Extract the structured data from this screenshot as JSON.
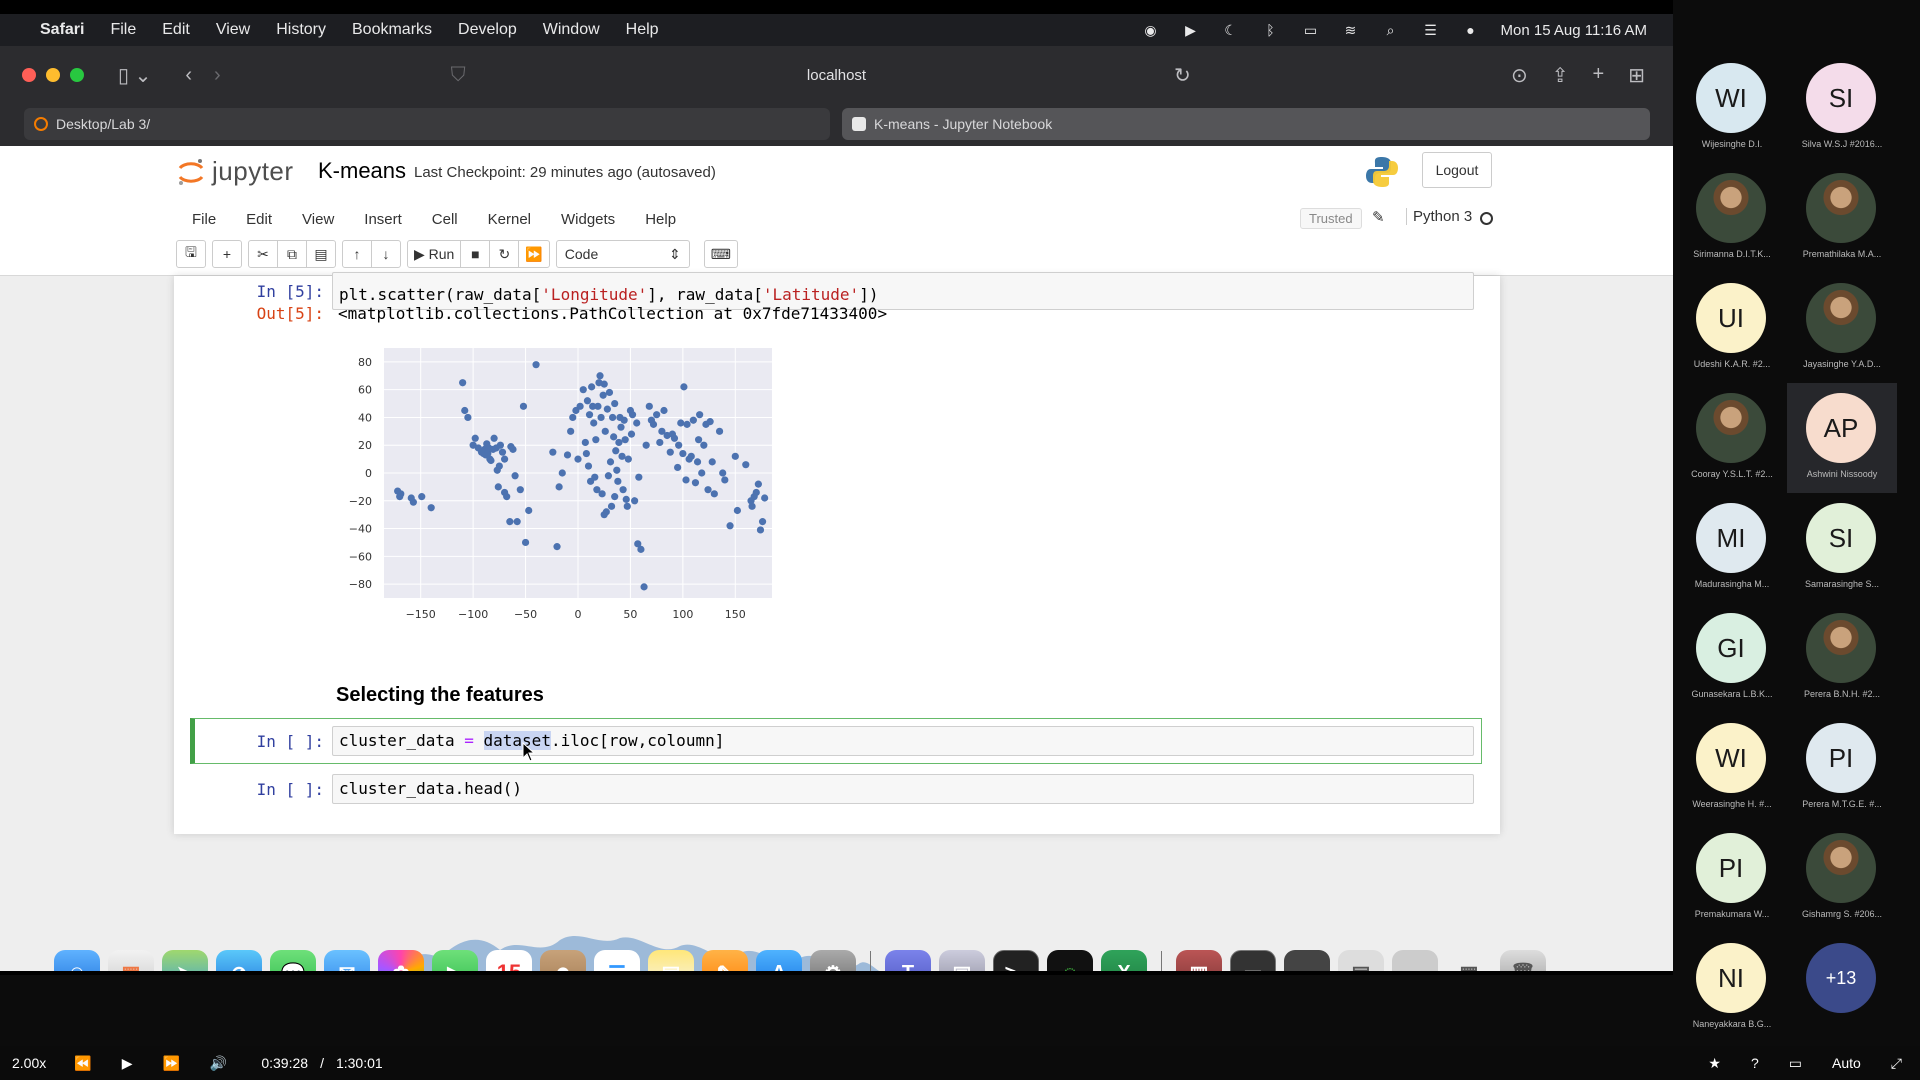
{
  "menubar": {
    "apple": "",
    "app": "Safari",
    "items": [
      "File",
      "Edit",
      "View",
      "History",
      "Bookmarks",
      "Develop",
      "Window",
      "Help"
    ],
    "clock": "Mon 15 Aug  11:16 AM"
  },
  "safari": {
    "url": "localhost",
    "tabs": [
      "Desktop/Lab 3/",
      "K-means - Jupyter Notebook"
    ]
  },
  "jupyter": {
    "logo_text": "jupyter",
    "notebook_title": "K-means",
    "checkpoint": "Last Checkpoint: 29 minutes ago  (autosaved)",
    "logout": "Logout",
    "menu": [
      "File",
      "Edit",
      "View",
      "Insert",
      "Cell",
      "Kernel",
      "Widgets",
      "Help"
    ],
    "trusted": "Trusted",
    "kernel": "Python 3",
    "toolbar": {
      "run": "Run",
      "cell_type": "Code"
    }
  },
  "cells": {
    "c1": {
      "prompt": "In [5]:",
      "code_a": "plt.scatter(raw_data[",
      "str1": "'Longitude'",
      "code_b": "], raw_data[",
      "str2": "'Latitude'",
      "code_c": "])",
      "out_prompt": "Out[5]:",
      "output": "<matplotlib.collections.PathCollection at 0x7fde71433400>"
    },
    "heading": "Selecting the features",
    "c2": {
      "prompt": "In [ ]:",
      "code_a": "cluster_data ",
      "op": "=",
      "code_sel": "dataset",
      "code_b": ".iloc[row,coloumn]"
    },
    "c3": {
      "prompt": "In [ ]:",
      "code": "cluster_data.head()"
    }
  },
  "chart_data": {
    "type": "scatter",
    "title": "",
    "xlabel": "",
    "ylabel": "",
    "xlim": [
      -185,
      185
    ],
    "ylim": [
      -90,
      90
    ],
    "xticks": [
      -150,
      -100,
      -50,
      0,
      50,
      100,
      150
    ],
    "yticks": [
      80,
      60,
      40,
      20,
      0,
      -20,
      -40,
      -60,
      -80
    ],
    "x_tick_labels": [
      "−150",
      "−100",
      "−50",
      "0",
      "50",
      "100",
      "150"
    ],
    "y_tick_labels": [
      "80",
      "60",
      "40",
      "20",
      "0",
      "−20",
      "−40",
      "−60",
      "−80"
    ],
    "grid": true,
    "color": "#4c72b0",
    "background": "#eaeaf2",
    "points": [
      [
        -172,
        -13
      ],
      [
        -170,
        -17
      ],
      [
        -169,
        -15
      ],
      [
        -159,
        -18
      ],
      [
        -157,
        -21
      ],
      [
        -149,
        -17
      ],
      [
        -140,
        -25
      ],
      [
        -110,
        65
      ],
      [
        -108,
        45
      ],
      [
        -105,
        40
      ],
      [
        -100,
        20
      ],
      [
        -98,
        25
      ],
      [
        -95,
        18
      ],
      [
        -92,
        15
      ],
      [
        -90,
        14
      ],
      [
        -89,
        17
      ],
      [
        -88,
        13
      ],
      [
        -87,
        21
      ],
      [
        -86,
        14
      ],
      [
        -85,
        18
      ],
      [
        -84,
        10
      ],
      [
        -83,
        9
      ],
      [
        -81,
        17
      ],
      [
        -80,
        25
      ],
      [
        -78,
        18
      ],
      [
        -77,
        2
      ],
      [
        -76,
        -10
      ],
      [
        -75,
        5
      ],
      [
        -74,
        20
      ],
      [
        -72,
        15
      ],
      [
        -70,
        -14
      ],
      [
        -70,
        10
      ],
      [
        -68,
        -17
      ],
      [
        -65,
        -35
      ],
      [
        -64,
        19
      ],
      [
        -62,
        17
      ],
      [
        -60,
        -2
      ],
      [
        -58,
        -35
      ],
      [
        -55,
        -12
      ],
      [
        -52,
        48
      ],
      [
        -50,
        -50
      ],
      [
        -47,
        -27
      ],
      [
        -40,
        78
      ],
      [
        -24,
        15
      ],
      [
        -20,
        -53
      ],
      [
        -18,
        -10
      ],
      [
        -15,
        0
      ],
      [
        -10,
        13
      ],
      [
        -7,
        30
      ],
      [
        -5,
        40
      ],
      [
        -2,
        45
      ],
      [
        0,
        10
      ],
      [
        2,
        48
      ],
      [
        5,
        60
      ],
      [
        7,
        22
      ],
      [
        8,
        14
      ],
      [
        9,
        52
      ],
      [
        10,
        5
      ],
      [
        11,
        42
      ],
      [
        12,
        -6
      ],
      [
        13,
        62
      ],
      [
        14,
        48
      ],
      [
        15,
        36
      ],
      [
        16,
        -3
      ],
      [
        17,
        24
      ],
      [
        18,
        -12
      ],
      [
        19,
        48
      ],
      [
        20,
        65
      ],
      [
        21,
        70
      ],
      [
        22,
        40
      ],
      [
        23,
        -15
      ],
      [
        24,
        56
      ],
      [
        25,
        -30
      ],
      [
        25,
        64
      ],
      [
        26,
        30
      ],
      [
        27,
        -28
      ],
      [
        28,
        46
      ],
      [
        29,
        -2
      ],
      [
        30,
        58
      ],
      [
        31,
        8
      ],
      [
        32,
        -24
      ],
      [
        33,
        40
      ],
      [
        34,
        26
      ],
      [
        35,
        50
      ],
      [
        35,
        -17
      ],
      [
        36,
        16
      ],
      [
        37,
        2
      ],
      [
        38,
        -6
      ],
      [
        39,
        22
      ],
      [
        40,
        40
      ],
      [
        41,
        33
      ],
      [
        42,
        12
      ],
      [
        43,
        -12
      ],
      [
        44,
        38
      ],
      [
        45,
        24
      ],
      [
        46,
        -19
      ],
      [
        47,
        -24
      ],
      [
        48,
        10
      ],
      [
        50,
        45
      ],
      [
        51,
        28
      ],
      [
        52,
        42
      ],
      [
        54,
        -20
      ],
      [
        56,
        36
      ],
      [
        57,
        -51
      ],
      [
        58,
        -3
      ],
      [
        60,
        -55
      ],
      [
        63,
        -82
      ],
      [
        65,
        20
      ],
      [
        68,
        48
      ],
      [
        70,
        38
      ],
      [
        72,
        35
      ],
      [
        75,
        42
      ],
      [
        78,
        22
      ],
      [
        80,
        30
      ],
      [
        82,
        45
      ],
      [
        85,
        27
      ],
      [
        88,
        15
      ],
      [
        90,
        28
      ],
      [
        92,
        25
      ],
      [
        95,
        4
      ],
      [
        96,
        20
      ],
      [
        98,
        36
      ],
      [
        100,
        14
      ],
      [
        101,
        62
      ],
      [
        103,
        -5
      ],
      [
        104,
        35
      ],
      [
        106,
        10
      ],
      [
        108,
        12
      ],
      [
        110,
        38
      ],
      [
        112,
        -7
      ],
      [
        114,
        8
      ],
      [
        115,
        24
      ],
      [
        116,
        42
      ],
      [
        118,
        0
      ],
      [
        120,
        20
      ],
      [
        122,
        35
      ],
      [
        124,
        -12
      ],
      [
        126,
        37
      ],
      [
        128,
        8
      ],
      [
        130,
        -15
      ],
      [
        135,
        30
      ],
      [
        138,
        0
      ],
      [
        140,
        -5
      ],
      [
        145,
        -38
      ],
      [
        150,
        12
      ],
      [
        152,
        -27
      ],
      [
        160,
        6
      ],
      [
        165,
        -20
      ],
      [
        166,
        -24
      ],
      [
        168,
        -17
      ],
      [
        170,
        -14
      ],
      [
        172,
        -8
      ],
      [
        174,
        -41
      ],
      [
        176,
        -35
      ],
      [
        178,
        -18
      ]
    ]
  },
  "dock": {
    "calendar_day": "15",
    "apps": [
      "finder",
      "launchpad",
      "maps",
      "safari",
      "messages",
      "mail",
      "photos",
      "facetime",
      "calendar",
      "contacts",
      "reminders",
      "notes",
      "pages",
      "app-store",
      "system-preferences",
      "teams",
      "preview",
      "terminal",
      "activity",
      "excel",
      "photo-booth",
      "screenshot",
      "trash"
    ]
  },
  "player": {
    "speed": "2.00x",
    "current": "0:39:28",
    "separator": "/",
    "total": "1:30:01",
    "quality": "Auto"
  },
  "participants": [
    {
      "initials": "WI",
      "name": "Wijesinghe D.I.",
      "color": "#d8e8f0"
    },
    {
      "initials": "SI",
      "name": "Silva W.S.J #2016...",
      "color": "#f4dcea"
    },
    {
      "initials": "",
      "name": "Sirimanna D.I.T.K...",
      "color": ""
    },
    {
      "initials": "",
      "name": "Premathilaka M.A...",
      "color": ""
    },
    {
      "initials": "UI",
      "name": "Udeshi K.A.R. #2...",
      "color": "#fbf2c9"
    },
    {
      "initials": "",
      "name": "Jayasinghe Y.A.D...",
      "color": ""
    },
    {
      "initials": "",
      "name": "Cooray Y.S.L.T. #2...",
      "color": ""
    },
    {
      "initials": "AP",
      "name": "Ashwini Nissoody",
      "color": "#f7dccd"
    },
    {
      "initials": "MI",
      "name": "Madurasingha M...",
      "color": "#dfe9ef"
    },
    {
      "initials": "SI",
      "name": "Samarasinghe S...",
      "color": "#e1f0d9"
    },
    {
      "initials": "GI",
      "name": "Gunasekara L.B.K...",
      "color": "#d9efe1"
    },
    {
      "initials": "",
      "name": "Perera B.N.H. #2...",
      "color": ""
    },
    {
      "initials": "WI",
      "name": "Weerasinghe H. #...",
      "color": "#fbf2c9"
    },
    {
      "initials": "PI",
      "name": "Perera M.T.G.E. #...",
      "color": "#dfe9ef"
    },
    {
      "initials": "PI",
      "name": "Premakumara W...",
      "color": "#e1f0d9"
    },
    {
      "initials": "",
      "name": "Gishamrg S. #206...",
      "color": ""
    },
    {
      "initials": "NI",
      "name": "Naneyakkara B.G...",
      "color": "#fbf2c9"
    },
    {
      "initials": "+13",
      "name": "",
      "color": "#3b4a8a"
    }
  ]
}
